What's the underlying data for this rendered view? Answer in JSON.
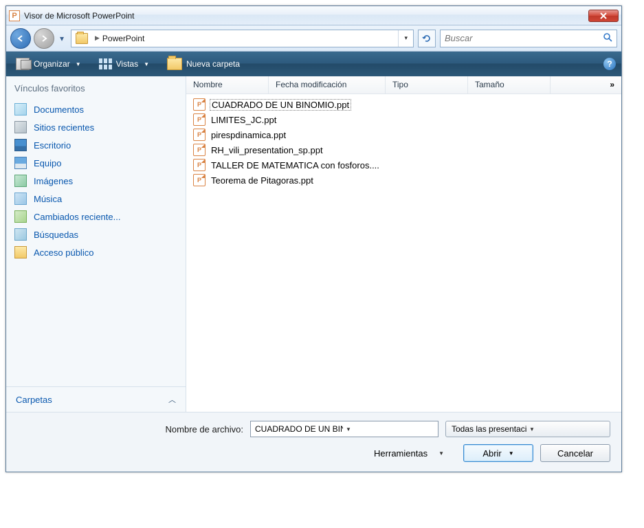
{
  "titlebar": {
    "title": "Visor de Microsoft PowerPoint"
  },
  "addressbar": {
    "location": "PowerPoint"
  },
  "search": {
    "placeholder": "Buscar"
  },
  "toolbar": {
    "organize": "Organizar",
    "views": "Vistas",
    "newfolder": "Nueva carpeta"
  },
  "sidebar": {
    "header": "Vínculos favoritos",
    "items": [
      {
        "label": "Documentos"
      },
      {
        "label": "Sitios recientes"
      },
      {
        "label": "Escritorio"
      },
      {
        "label": "Equipo"
      },
      {
        "label": "Imágenes"
      },
      {
        "label": "Música"
      },
      {
        "label": "Cambiados reciente..."
      },
      {
        "label": "Búsquedas"
      },
      {
        "label": "Acceso público"
      }
    ],
    "footer": "Carpetas"
  },
  "columns": {
    "name": "Nombre",
    "date": "Fecha modificación",
    "type": "Tipo",
    "size": "Tamaño",
    "more": "»"
  },
  "files": [
    {
      "name": "CUADRADO DE UN BINOMIO.ppt",
      "selected": true
    },
    {
      "name": "LIMITES_JC.ppt",
      "selected": false
    },
    {
      "name": "pirespdinamica.ppt",
      "selected": false
    },
    {
      "name": "RH_vili_presentation_sp.ppt",
      "selected": false
    },
    {
      "name": "TALLER DE MATEMATICA con fosforos....",
      "selected": false
    },
    {
      "name": "Teorema de Pitagoras.ppt",
      "selected": false
    }
  ],
  "footer": {
    "filename_label": "Nombre de archivo:",
    "filename_value": "CUADRADO DE UN BINOMIO.p",
    "filter_value": "Todas las presentaciones de",
    "tools": "Herramientas",
    "open": "Abrir",
    "cancel": "Cancelar"
  }
}
